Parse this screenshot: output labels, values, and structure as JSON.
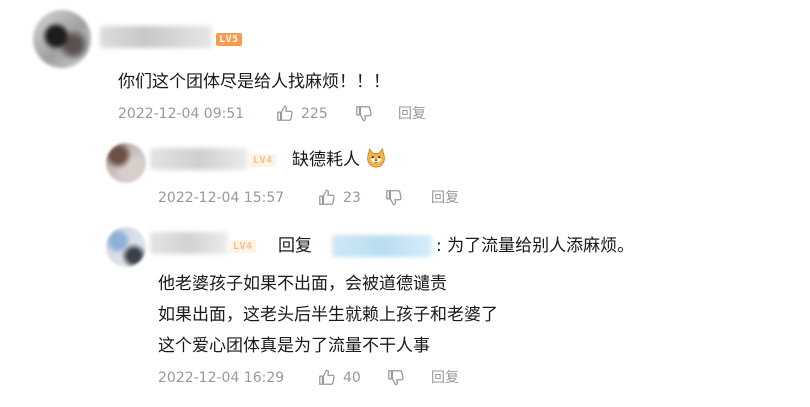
{
  "comments": [
    {
      "text": "你们这个团体尽是给人找麻烦！！！",
      "level": "LV5",
      "time": "2022-12-04 09:51",
      "likes": "225",
      "reply_label": "回复"
    },
    {
      "text": "缺德耗人",
      "emoji": "doge-emoji",
      "level": "LV4",
      "time": "2022-12-04 15:57",
      "likes": "23",
      "reply_label": "回复"
    },
    {
      "reply_prefix": "回复",
      "reply_suffix": ": 为了流量给别人添麻烦。",
      "lines": [
        "他老婆孩子如果不出面，会被道德谴责",
        "如果出面，这老头后半生就赖上孩子和老婆了",
        "这个爱心团体真是为了流量不干人事"
      ],
      "level": "LV4",
      "time": "2022-12-04 16:29",
      "likes": "40",
      "reply_label": "回复"
    }
  ],
  "colors": {
    "meta": "#9499a0",
    "text": "#18191c",
    "level_badge_lv5": "#ff9a4d"
  },
  "icons": [
    "thumbs-up-icon",
    "thumbs-down-icon"
  ]
}
